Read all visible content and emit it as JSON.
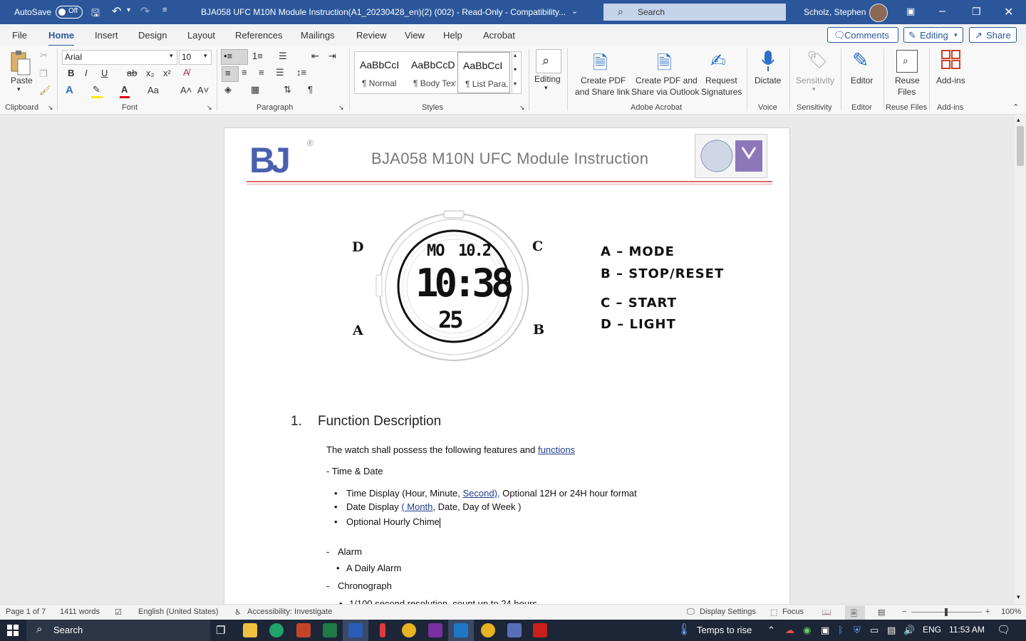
{
  "titlebar": {
    "autosave_label": "AutoSave",
    "autosave_state": "Off",
    "doc_title": "BJA058  UFC M10N Module Instruction(A1_20230428_en)(2) (002)  -  Read-Only  -  Compatibility...",
    "search_placeholder": "Search",
    "user_name": "Scholz, Stephen",
    "accent": "#2b579a"
  },
  "menu": {
    "tabs": [
      "File",
      "Home",
      "Insert",
      "Design",
      "Layout",
      "References",
      "Mailings",
      "Review",
      "View",
      "Help",
      "Acrobat"
    ],
    "comments_label": "Comments",
    "editing_label": "Editing",
    "share_label": "Share"
  },
  "ribbon": {
    "clipboard": {
      "paste": "Paste",
      "group": "Clipboard"
    },
    "font": {
      "name": "Arial",
      "size": "10",
      "group": "Font"
    },
    "paragraph": {
      "group": "Paragraph"
    },
    "styles": {
      "items": [
        {
          "sample": "AaBbCcI",
          "name": "¶ Normal"
        },
        {
          "sample": "AaBbCcD",
          "name": "¶ Body Text"
        },
        {
          "sample": "AaBbCcI",
          "name": "¶ List Para..."
        }
      ],
      "group": "Styles"
    },
    "editing": {
      "label": "Editing"
    },
    "acrobat": {
      "create_pdf": [
        "Create PDF",
        "and Share link"
      ],
      "create_pdf_outlook": [
        "Create PDF and",
        "Share via Outlook"
      ],
      "request_sig": [
        "Request",
        "Signatures"
      ],
      "group": "Adobe Acrobat"
    },
    "voice": {
      "dictate": "Dictate",
      "group": "Voice"
    },
    "sensitivity": {
      "label": "Sensitivity",
      "group": "Sensitivity"
    },
    "editor": {
      "label": "Editor",
      "group": "Editor"
    },
    "reuse": {
      "label": [
        "Reuse",
        "Files"
      ],
      "group": "Reuse Files"
    },
    "addins": {
      "label": "Add-ins",
      "group": "Add-ins"
    }
  },
  "document": {
    "logo_text": "BJ",
    "registered_mark": "®",
    "header_title": "BJA058 M10N UFC Module Instruction",
    "watch": {
      "top_left": "MO",
      "top_right": "10.2",
      "main_time": "10:38",
      "seconds": "25",
      "button_labels": {
        "d": "D",
        "c": "C",
        "a": "A",
        "b": "B"
      }
    },
    "legend": [
      "A – MODE",
      "B – STOP/RESET",
      "C – START",
      "D – LIGHT"
    ],
    "section_number": "1.",
    "section_title": "Function Description",
    "intro_pre": "The watch shall possess the following features and ",
    "intro_link": "functions",
    "time_date_heading": "-  Time & Date",
    "bullet1_pre": "Time Display (Hour, Minute, ",
    "bullet1_link": "Second),",
    "bullet1_post": "  Optional 12H or 24H hour format",
    "bullet2_pre": "Date Display ",
    "bullet2_link": "( Month",
    "bullet2_post": ", Date, Day of Week )",
    "bullet3": "Optional Hourly Chime",
    "alarm_heading": "Alarm",
    "alarm_bullet": "A Daily Alarm",
    "chrono_heading": "Chronograph",
    "chrono_bullet": "1/100   second resolution, count up to 24 hours"
  },
  "statusbar": {
    "page": "Page 1 of 7",
    "words": "1411 words",
    "language": "English (United States)",
    "accessibility": "Accessibility: Investigate",
    "display_settings": "Display Settings",
    "focus": "Focus",
    "zoom": "100%"
  },
  "taskbar": {
    "search": "Search",
    "weather": "Temps to rise",
    "lang": "ENG",
    "time": "11:53 AM"
  }
}
